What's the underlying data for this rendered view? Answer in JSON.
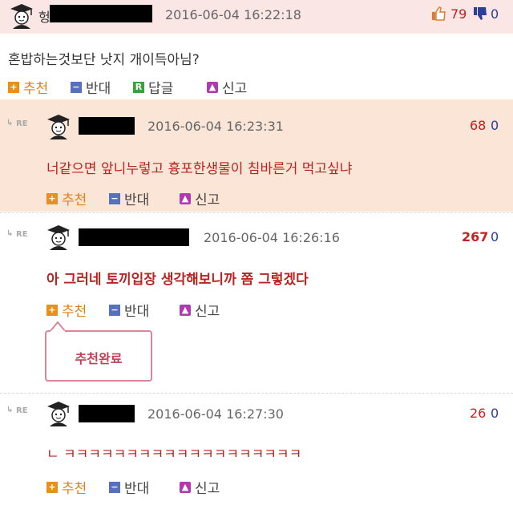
{
  "comments": [
    {
      "nick_visible": "헝",
      "date": "2016-06-04 16:22:18",
      "likes": "79",
      "dislikes": "0",
      "text": "혼밥하는것보단 낫지 개이득아님?",
      "actions": {
        "recommend": "추천",
        "oppose": "반대",
        "reply_icon": "R",
        "reply": "답글",
        "report": "신고"
      }
    },
    {
      "re": "RE",
      "date": "2016-06-04 16:23:31",
      "likes": "68",
      "dislikes": "0",
      "text": "너같으면 앞니누렇고 흉포한생물이 침바른거 먹고싶냐",
      "actions": {
        "recommend": "추천",
        "oppose": "반대",
        "report": "신고"
      }
    },
    {
      "re": "RE",
      "date": "2016-06-04 16:26:16",
      "likes": "267",
      "dislikes": "0",
      "text": "아 그러네 토끼입장 생각해보니까 쫌 그렇겠다",
      "actions": {
        "recommend": "추천",
        "oppose": "반대",
        "report": "신고"
      },
      "tooltip": "추천완료"
    },
    {
      "re": "RE",
      "date": "2016-06-04 16:27:30",
      "likes": "26",
      "dislikes": "0",
      "text": "ㄴ ㅋㅋㅋㅋㅋㅋㅋㅋㅋㅋㅋㅋㅋㅋㅋㅋㅋㅋㅋ",
      "actions": {
        "recommend": "추천",
        "oppose": "반대",
        "report": "신고"
      }
    }
  ],
  "colors": {
    "header_pink": "#fbe6e6",
    "reply_peach": "#fae5d6",
    "count_red": "#c22222",
    "count_blue": "#2a3e9a"
  }
}
